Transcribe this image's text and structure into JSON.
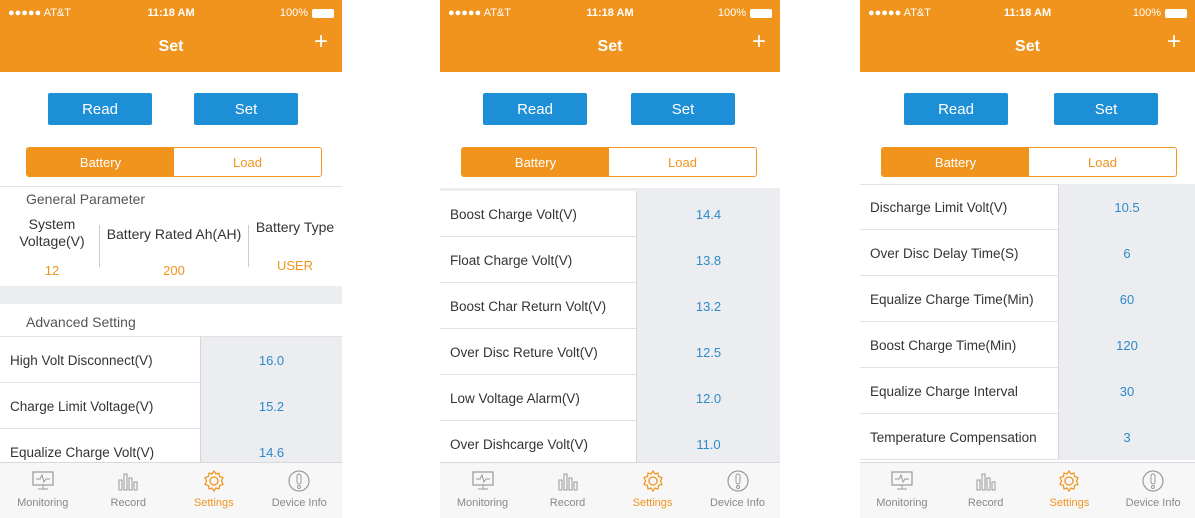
{
  "status": {
    "carrier": "●●●●● AT&T",
    "time": "11:18 AM",
    "battery": "100%"
  },
  "header": {
    "title": "Set",
    "plus": "+"
  },
  "buttons": {
    "read": "Read",
    "set": "Set"
  },
  "segment": {
    "battery": "Battery",
    "load": "Load"
  },
  "tabs": [
    "Monitoring",
    "Record",
    "Settings",
    "Device Info"
  ],
  "screen1": {
    "general_title": "General Parameter",
    "system_voltage_label_1": "System",
    "system_voltage_label_2": "Voltage(V)",
    "system_voltage_value": "12",
    "rated_ah_label": "Battery Rated Ah(AH)",
    "rated_ah_value": "200",
    "battery_type_label": "Battery Type",
    "battery_type_value": "USER",
    "advanced_title": "Advanced Setting",
    "rows": [
      {
        "label": "High Volt Disconnect(V)",
        "value": "16.0"
      },
      {
        "label": "Charge Limit Voltage(V)",
        "value": "15.2"
      },
      {
        "label": "Equalize Charge Volt(V)",
        "value": "14.6"
      }
    ]
  },
  "screen2": {
    "rows": [
      {
        "label": "Boost Charge Volt(V)",
        "value": "14.4"
      },
      {
        "label": "Float Charge Volt(V)",
        "value": "13.8"
      },
      {
        "label": "Boost Char Return Volt(V)",
        "value": "13.2"
      },
      {
        "label": "Over Disc Reture Volt(V)",
        "value": "12.5"
      },
      {
        "label": "Low Voltage Alarm(V)",
        "value": "12.0"
      },
      {
        "label": "Over Dishcarge Volt(V)",
        "value": "11.0"
      }
    ]
  },
  "screen3": {
    "rows": [
      {
        "label": "Discharge Limit Volt(V)",
        "value": "10.5"
      },
      {
        "label": "Over Disc Delay Time(S)",
        "value": "6"
      },
      {
        "label": "Equalize Charge Time(Min)",
        "value": "60"
      },
      {
        "label": "Boost Charge Time(Min)",
        "value": "120"
      },
      {
        "label": "Equalize Charge Interval",
        "value": "30"
      },
      {
        "label": "Temperature Compensation",
        "value": "3"
      }
    ]
  },
  "icons": [
    "monitor-icon",
    "bar-chart-icon",
    "gear-icon",
    "info-icon"
  ],
  "colors": {
    "accent": "#f0941e",
    "button": "#1d8fd6",
    "value_text": "#2e8ac8",
    "value_bg": "#ecedf1"
  }
}
